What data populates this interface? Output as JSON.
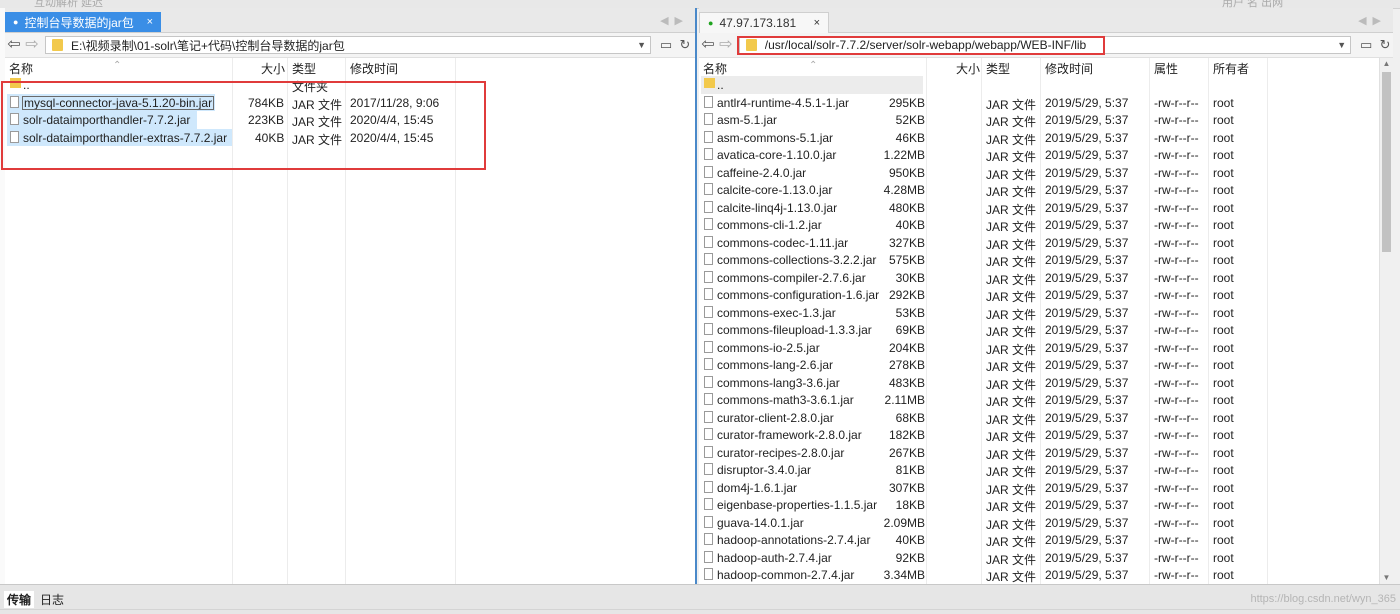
{
  "top_strip": {
    "left_ghost": "互动解析 延迟",
    "right_ghost": "用户 名 出网"
  },
  "left_panel": {
    "tab_label": "控制台导数据的jar包",
    "tab_close": "×",
    "path": "E:\\视频录制\\01-solr\\笔记+代码\\控制台导数据的jar包",
    "columns": {
      "name": "名称",
      "size": "大小",
      "type": "类型",
      "modified": "修改时间"
    },
    "updir": {
      "name": "..",
      "type": "文件夹"
    },
    "files": [
      {
        "name": "mysql-connector-java-5.1.20-bin.jar",
        "size": "784KB",
        "type": "JAR 文件",
        "modified": "2017/11/28, 9:06"
      },
      {
        "name": "solr-dataimporthandler-7.7.2.jar",
        "size": "223KB",
        "type": "JAR 文件",
        "modified": "2020/4/4, 15:45"
      },
      {
        "name": "solr-dataimporthandler-extras-7.7.2.jar",
        "size": "40KB",
        "type": "JAR 文件",
        "modified": "2020/4/4, 15:45"
      }
    ]
  },
  "right_panel": {
    "tab_label": "47.97.173.181",
    "tab_close": "×",
    "path": "/usr/local/solr-7.7.2/server/solr-webapp/webapp/WEB-INF/lib",
    "columns": {
      "name": "名称",
      "size": "大小",
      "type": "类型",
      "modified": "修改时间",
      "attrs": "属性",
      "owner": "所有者"
    },
    "updir": {
      "name": ".."
    },
    "files": [
      {
        "name": "antlr4-runtime-4.5.1-1.jar",
        "size": "295KB",
        "type": "JAR 文件",
        "modified": "2019/5/29, 5:37",
        "attrs": "-rw-r--r--",
        "owner": "root"
      },
      {
        "name": "asm-5.1.jar",
        "size": "52KB",
        "type": "JAR 文件",
        "modified": "2019/5/29, 5:37",
        "attrs": "-rw-r--r--",
        "owner": "root"
      },
      {
        "name": "asm-commons-5.1.jar",
        "size": "46KB",
        "type": "JAR 文件",
        "modified": "2019/5/29, 5:37",
        "attrs": "-rw-r--r--",
        "owner": "root"
      },
      {
        "name": "avatica-core-1.10.0.jar",
        "size": "1.22MB",
        "type": "JAR 文件",
        "modified": "2019/5/29, 5:37",
        "attrs": "-rw-r--r--",
        "owner": "root"
      },
      {
        "name": "caffeine-2.4.0.jar",
        "size": "950KB",
        "type": "JAR 文件",
        "modified": "2019/5/29, 5:37",
        "attrs": "-rw-r--r--",
        "owner": "root"
      },
      {
        "name": "calcite-core-1.13.0.jar",
        "size": "4.28MB",
        "type": "JAR 文件",
        "modified": "2019/5/29, 5:37",
        "attrs": "-rw-r--r--",
        "owner": "root"
      },
      {
        "name": "calcite-linq4j-1.13.0.jar",
        "size": "480KB",
        "type": "JAR 文件",
        "modified": "2019/5/29, 5:37",
        "attrs": "-rw-r--r--",
        "owner": "root"
      },
      {
        "name": "commons-cli-1.2.jar",
        "size": "40KB",
        "type": "JAR 文件",
        "modified": "2019/5/29, 5:37",
        "attrs": "-rw-r--r--",
        "owner": "root"
      },
      {
        "name": "commons-codec-1.11.jar",
        "size": "327KB",
        "type": "JAR 文件",
        "modified": "2019/5/29, 5:37",
        "attrs": "-rw-r--r--",
        "owner": "root"
      },
      {
        "name": "commons-collections-3.2.2.jar",
        "size": "575KB",
        "type": "JAR 文件",
        "modified": "2019/5/29, 5:37",
        "attrs": "-rw-r--r--",
        "owner": "root"
      },
      {
        "name": "commons-compiler-2.7.6.jar",
        "size": "30KB",
        "type": "JAR 文件",
        "modified": "2019/5/29, 5:37",
        "attrs": "-rw-r--r--",
        "owner": "root"
      },
      {
        "name": "commons-configuration-1.6.jar",
        "size": "292KB",
        "type": "JAR 文件",
        "modified": "2019/5/29, 5:37",
        "attrs": "-rw-r--r--",
        "owner": "root"
      },
      {
        "name": "commons-exec-1.3.jar",
        "size": "53KB",
        "type": "JAR 文件",
        "modified": "2019/5/29, 5:37",
        "attrs": "-rw-r--r--",
        "owner": "root"
      },
      {
        "name": "commons-fileupload-1.3.3.jar",
        "size": "69KB",
        "type": "JAR 文件",
        "modified": "2019/5/29, 5:37",
        "attrs": "-rw-r--r--",
        "owner": "root"
      },
      {
        "name": "commons-io-2.5.jar",
        "size": "204KB",
        "type": "JAR 文件",
        "modified": "2019/5/29, 5:37",
        "attrs": "-rw-r--r--",
        "owner": "root"
      },
      {
        "name": "commons-lang-2.6.jar",
        "size": "278KB",
        "type": "JAR 文件",
        "modified": "2019/5/29, 5:37",
        "attrs": "-rw-r--r--",
        "owner": "root"
      },
      {
        "name": "commons-lang3-3.6.jar",
        "size": "483KB",
        "type": "JAR 文件",
        "modified": "2019/5/29, 5:37",
        "attrs": "-rw-r--r--",
        "owner": "root"
      },
      {
        "name": "commons-math3-3.6.1.jar",
        "size": "2.11MB",
        "type": "JAR 文件",
        "modified": "2019/5/29, 5:37",
        "attrs": "-rw-r--r--",
        "owner": "root"
      },
      {
        "name": "curator-client-2.8.0.jar",
        "size": "68KB",
        "type": "JAR 文件",
        "modified": "2019/5/29, 5:37",
        "attrs": "-rw-r--r--",
        "owner": "root"
      },
      {
        "name": "curator-framework-2.8.0.jar",
        "size": "182KB",
        "type": "JAR 文件",
        "modified": "2019/5/29, 5:37",
        "attrs": "-rw-r--r--",
        "owner": "root"
      },
      {
        "name": "curator-recipes-2.8.0.jar",
        "size": "267KB",
        "type": "JAR 文件",
        "modified": "2019/5/29, 5:37",
        "attrs": "-rw-r--r--",
        "owner": "root"
      },
      {
        "name": "disruptor-3.4.0.jar",
        "size": "81KB",
        "type": "JAR 文件",
        "modified": "2019/5/29, 5:37",
        "attrs": "-rw-r--r--",
        "owner": "root"
      },
      {
        "name": "dom4j-1.6.1.jar",
        "size": "307KB",
        "type": "JAR 文件",
        "modified": "2019/5/29, 5:37",
        "attrs": "-rw-r--r--",
        "owner": "root"
      },
      {
        "name": "eigenbase-properties-1.1.5.jar",
        "size": "18KB",
        "type": "JAR 文件",
        "modified": "2019/5/29, 5:37",
        "attrs": "-rw-r--r--",
        "owner": "root"
      },
      {
        "name": "guava-14.0.1.jar",
        "size": "2.09MB",
        "type": "JAR 文件",
        "modified": "2019/5/29, 5:37",
        "attrs": "-rw-r--r--",
        "owner": "root"
      },
      {
        "name": "hadoop-annotations-2.7.4.jar",
        "size": "40KB",
        "type": "JAR 文件",
        "modified": "2019/5/29, 5:37",
        "attrs": "-rw-r--r--",
        "owner": "root"
      },
      {
        "name": "hadoop-auth-2.7.4.jar",
        "size": "92KB",
        "type": "JAR 文件",
        "modified": "2019/5/29, 5:37",
        "attrs": "-rw-r--r--",
        "owner": "root"
      },
      {
        "name": "hadoop-common-2.7.4.jar",
        "size": "3.34MB",
        "type": "JAR 文件",
        "modified": "2019/5/29, 5:37",
        "attrs": "-rw-r--r--",
        "owner": "root"
      }
    ]
  },
  "bottom_tabs": [
    "传输",
    "日志"
  ],
  "watermark": "https://blog.csdn.net/wyn_365",
  "colors": {
    "accent": "#3a8ee6",
    "highlight": "#e03b3b",
    "selection": "#cfe8fc",
    "folder": "#f2c94c",
    "online": "#1fa31f"
  },
  "icons": {
    "back": "arrow-left-icon",
    "forward": "arrow-right-icon",
    "folder": "folder-icon",
    "file": "file-icon",
    "refresh": "refresh-icon",
    "bookmark": "bookmark-icon"
  }
}
